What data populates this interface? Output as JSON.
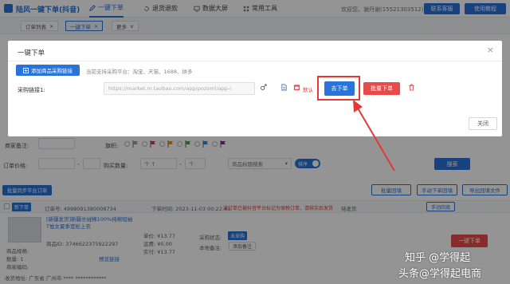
{
  "colors": {
    "primary": "#2a73d9",
    "danger": "#e84a4a",
    "annotation": "#e53935"
  },
  "header": {
    "logo_text": "陆风一键下单(抖音)",
    "tabs": [
      {
        "label": "一键下单",
        "icon": "edit-icon",
        "active": true
      },
      {
        "label": "退货退款",
        "icon": "refund-icon"
      },
      {
        "label": "数据大屏",
        "icon": "monitor-icon"
      },
      {
        "label": "常用工具",
        "icon": "tools-icon"
      }
    ],
    "welcome": "欢迎您，谢丹谢(15521303512)",
    "contact_button": "联系客服",
    "tutorial_button": "使用教程"
  },
  "page_tabs": {
    "items": [
      {
        "label": "订单列表",
        "close": "×"
      },
      {
        "label": "一键下单",
        "close": "×",
        "active": true
      }
    ],
    "more": {
      "label": "更多",
      "chevron": "∨"
    }
  },
  "modal": {
    "title": "一键下单",
    "close": "×",
    "add_link_button": "添加商品采购链接",
    "supported_hint": "当前支持采购平台：淘宝、天猫、1688、拼多",
    "link_row": {
      "label": "采购链接1:",
      "value": "https://market.m.taobao.com/app/pozoml/app-i",
      "default_label": "默认",
      "order_button": "去下单",
      "batch_button": "批量下单"
    },
    "close_button": "关闭"
  },
  "filters": {
    "merchant_note_label": "商家备注:",
    "flag_label": "旗帜:",
    "flags": [
      {
        "color": "#9e9e9e"
      },
      {
        "color": "#e53935"
      },
      {
        "color": "#fb8c00"
      },
      {
        "color": "#43a047"
      },
      {
        "color": "#1e88e5"
      },
      {
        "color": "#8e24aa"
      }
    ],
    "price_label": "订单价格:",
    "range_separator": "-",
    "quantity_label": "购买数量:",
    "quantity_min": "个 ↑",
    "quantity_max": "个",
    "title_search_select": "商品标题搜索",
    "select_chevron": "▾",
    "sort_toggle": "排序",
    "search_button": "搜索"
  },
  "actions": {
    "sync_button": "批量同步平台订单",
    "batch_fill_button": "批量回填",
    "manual_fill_button": "手动下单回填",
    "export_button": "导出回填文件"
  },
  "order": {
    "status_tag": "新下单",
    "order_no": "订单号: 4998091380008734",
    "order_time": "下单时间: 2023-11-03 00:22:43",
    "warning": "该订单已被抖音平台标记为保税订单，请核实后发货",
    "ship_status": "待发货",
    "manual_fill_button": "手动回填",
    "product_title": "[新疆发货]新疆长绒棉100%纯棉短袖T恤女夏季宽松上衣",
    "spec_label": "商品规格:",
    "quantity": "数量: 1",
    "merchant_code": "商家编码:",
    "product_id": "商品ID: 3746622375922297",
    "preview_link": "预览链接",
    "unit_price": "单价: ¥13.77",
    "shipping_fee": "运费: ¥0.00",
    "paid": "实付: ¥13.77",
    "purchase_status_label": "采购状态:",
    "purchase_status": "未采购",
    "local_note_label": "本地备注:",
    "add_note_button": "添加备注",
    "one_click_button": "一键下单",
    "address": "收货地址: 广东省 广州市 **** ************"
  },
  "watermark": {
    "line1": "知乎 @学得起",
    "line2": "头条@学得起电商"
  }
}
